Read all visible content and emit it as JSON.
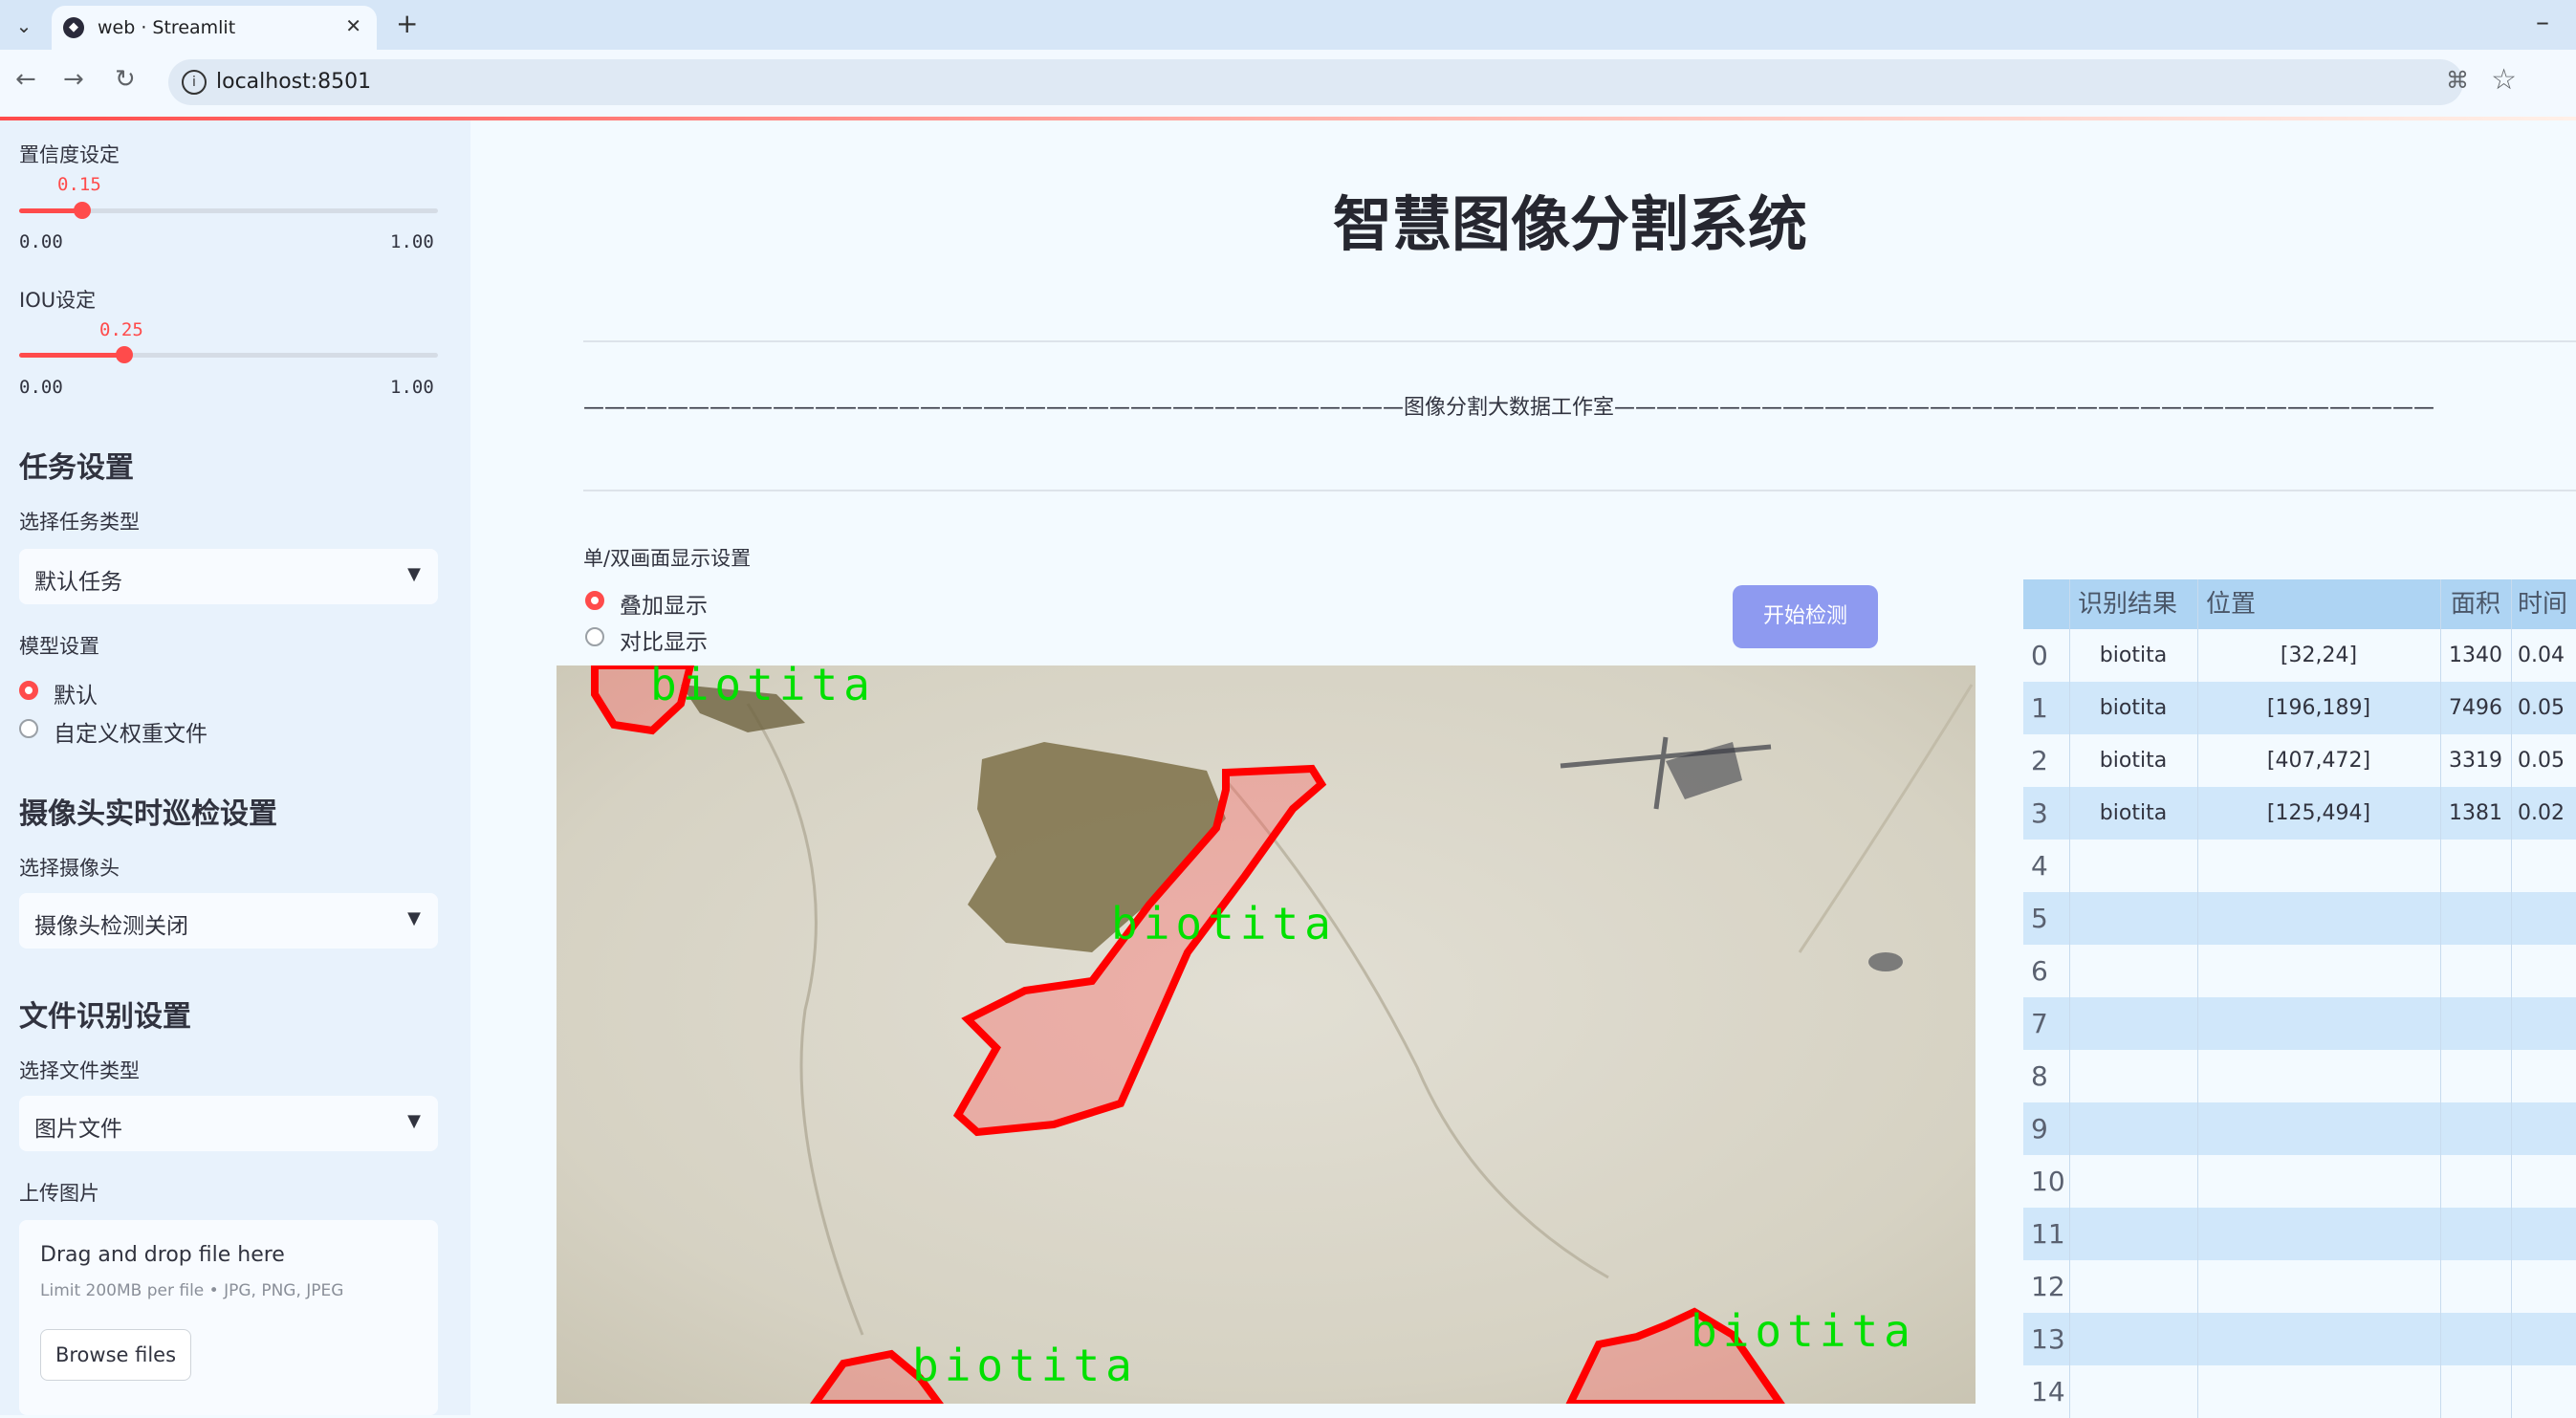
{
  "browser": {
    "tab_title": "web · Streamlit",
    "url": "localhost:8501"
  },
  "sidebar": {
    "confidence": {
      "label": "置信度设定",
      "value": "0.15",
      "value_fraction": 0.15,
      "min": "0.00",
      "max": "1.00"
    },
    "iou": {
      "label": "IOU设定",
      "value": "0.25",
      "value_fraction": 0.25,
      "min": "0.00",
      "max": "1.00"
    },
    "task_header": "任务设置",
    "task_type_label": "选择任务类型",
    "task_type_value": "默认任务",
    "model_label": "模型设置",
    "model_options": [
      "默认",
      "自定义权重文件"
    ],
    "camera_header": "摄像头实时巡检设置",
    "camera_label": "选择摄像头",
    "camera_value": "摄像头检测关闭",
    "file_header": "文件识别设置",
    "file_type_label": "选择文件类型",
    "file_type_value": "图片文件",
    "upload_label": "上传图片",
    "upload_drag": "Drag and drop file here",
    "upload_limit": "Limit 200MB per file • JPG, PNG, JPEG",
    "browse_label": "Browse files"
  },
  "main": {
    "title": "智慧图像分割系统",
    "divider_text": "———————————————————————————————————————图像分割大数据工作室———————————————————————————————————————",
    "display_label": "单/双画面显示设置",
    "display_options": [
      "叠加显示",
      "对比显示"
    ],
    "start_button": "开始检测",
    "detection_label": "biotita"
  },
  "table": {
    "headers": [
      "识别结果",
      "位置",
      "面积",
      "时间"
    ],
    "rows": [
      {
        "idx": "0",
        "result": "biotita",
        "pos": "[32,24]",
        "area": "1340",
        "time": "0.04"
      },
      {
        "idx": "1",
        "result": "biotita",
        "pos": "[196,189]",
        "area": "7496",
        "time": "0.05"
      },
      {
        "idx": "2",
        "result": "biotita",
        "pos": "[407,472]",
        "area": "3319",
        "time": "0.05"
      },
      {
        "idx": "3",
        "result": "biotita",
        "pos": "[125,494]",
        "area": "1381",
        "time": "0.02"
      },
      {
        "idx": "4",
        "result": "",
        "pos": "",
        "area": "",
        "time": ""
      },
      {
        "idx": "5",
        "result": "",
        "pos": "",
        "area": "",
        "time": ""
      },
      {
        "idx": "6",
        "result": "",
        "pos": "",
        "area": "",
        "time": ""
      },
      {
        "idx": "7",
        "result": "",
        "pos": "",
        "area": "",
        "time": ""
      },
      {
        "idx": "8",
        "result": "",
        "pos": "",
        "area": "",
        "time": ""
      },
      {
        "idx": "9",
        "result": "",
        "pos": "",
        "area": "",
        "time": ""
      },
      {
        "idx": "10",
        "result": "",
        "pos": "",
        "area": "",
        "time": ""
      },
      {
        "idx": "11",
        "result": "",
        "pos": "",
        "area": "",
        "time": ""
      },
      {
        "idx": "12",
        "result": "",
        "pos": "",
        "area": "",
        "time": ""
      },
      {
        "idx": "13",
        "result": "",
        "pos": "",
        "area": "",
        "time": ""
      },
      {
        "idx": "14",
        "result": "",
        "pos": "",
        "area": "",
        "time": ""
      }
    ]
  },
  "colors": {
    "accent": "#ff4b4b",
    "button": "#8e9af0",
    "mask": "#ff0000",
    "label": "#00e000"
  }
}
